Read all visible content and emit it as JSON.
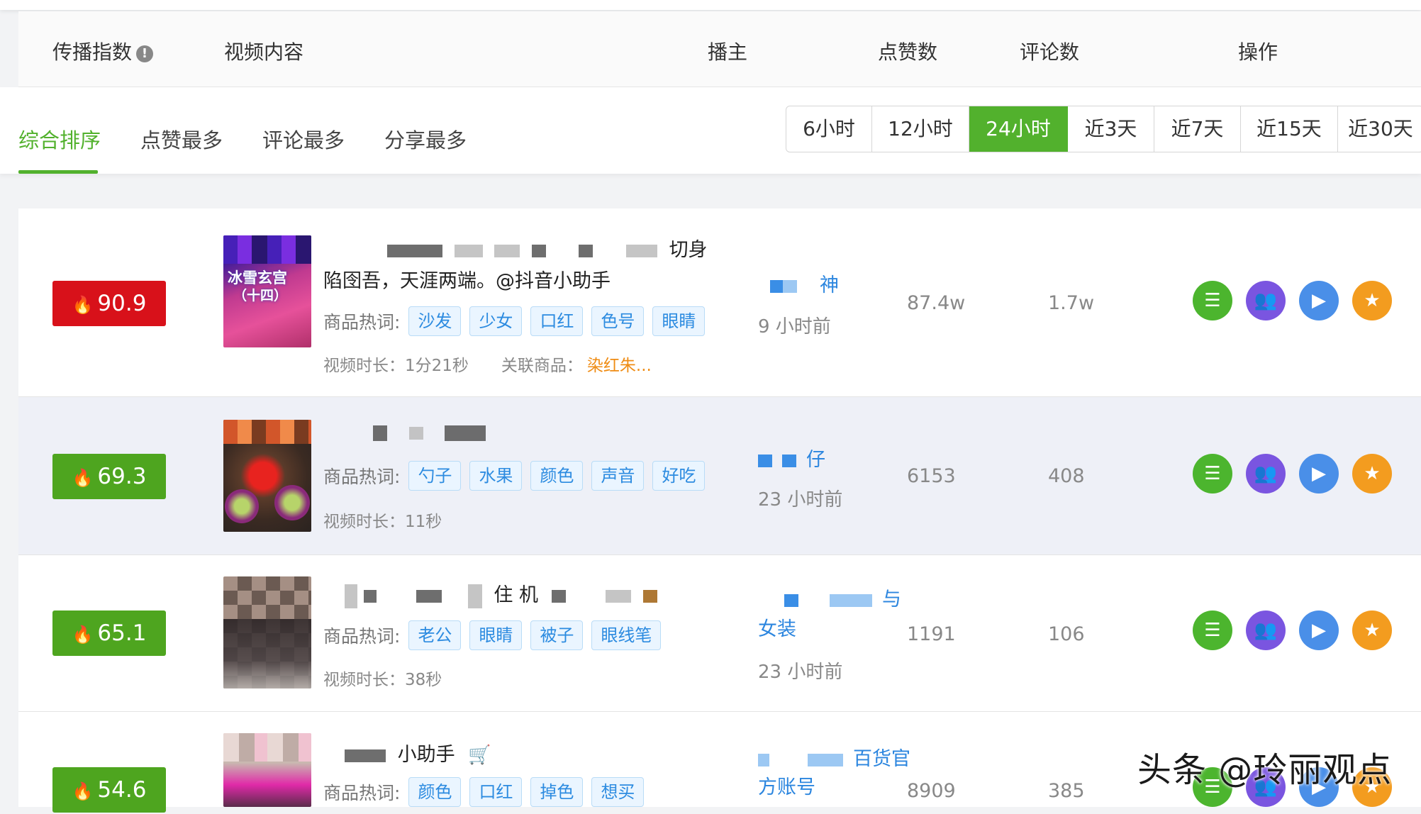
{
  "header": {
    "col_index": "传播指数",
    "col_video": "视频内容",
    "col_anchor": "播主",
    "col_likes": "点赞数",
    "col_comments": "评论数",
    "col_actions": "操作"
  },
  "sort_tabs": [
    "综合排序",
    "点赞最多",
    "评论最多",
    "分享最多"
  ],
  "time_filters": [
    "6小时",
    "12小时",
    "24小时",
    "近3天",
    "近7天",
    "近15天",
    "近30天"
  ],
  "active_time_filter": "24小时",
  "keywords_label": "商品热词:",
  "rows": [
    {
      "score": "90.9",
      "score_color": "#d8111a",
      "title_line1_tail": "切身",
      "title_line2": "陷囹吾，天涯两端。@抖音小助手",
      "keywords": [
        "沙发",
        "少女",
        "口红",
        "色号",
        "眼睛"
      ],
      "duration": "视频时长：1分21秒",
      "related_label": "关联商品：",
      "related_goods": "染红朱...",
      "anchor_name_tail": "神",
      "posted": "9 小时前",
      "likes": "87.4w",
      "comments": "1.7w",
      "thumb_text_1": "冰雪玄宫",
      "thumb_text_2": "（十四）"
    },
    {
      "score": "69.3",
      "score_color": "#4ea51f",
      "keywords": [
        "勺子",
        "水果",
        "颜色",
        "声音",
        "好吃"
      ],
      "duration": "视频时长：11秒",
      "anchor_name_tail": "仔",
      "posted": "23 小时前",
      "likes": "6153",
      "comments": "408"
    },
    {
      "score": "65.1",
      "score_color": "#4ea51f",
      "title_fragment": "住 机",
      "keywords": [
        "老公",
        "眼睛",
        "被子",
        "眼线笔"
      ],
      "duration": "视频时长：38秒",
      "anchor_name_tail": "与",
      "anchor_line2": "女装",
      "posted": "23 小时前",
      "likes": "1191",
      "comments": "106"
    },
    {
      "score": "54.6",
      "score_color": "#4ea51f",
      "title_fragment": "小助手",
      "keywords": [
        "颜色",
        "口红",
        "掉色",
        "想买"
      ],
      "anchor_name_tail": "百货官",
      "anchor_line2": "方账号",
      "likes": "8909",
      "comments": "385"
    }
  ],
  "icons": {
    "detail": "list-icon",
    "audience": "users-icon",
    "play": "play-icon",
    "favorite": "star-icon",
    "fire": "fire-icon",
    "cart": "cart-icon",
    "info": "exclamation-icon"
  },
  "colors": {
    "accent": "#52b12d",
    "tag_text": "#2c8be0",
    "goods": "#ef8c14"
  },
  "watermark": "头条 @玲丽观点"
}
